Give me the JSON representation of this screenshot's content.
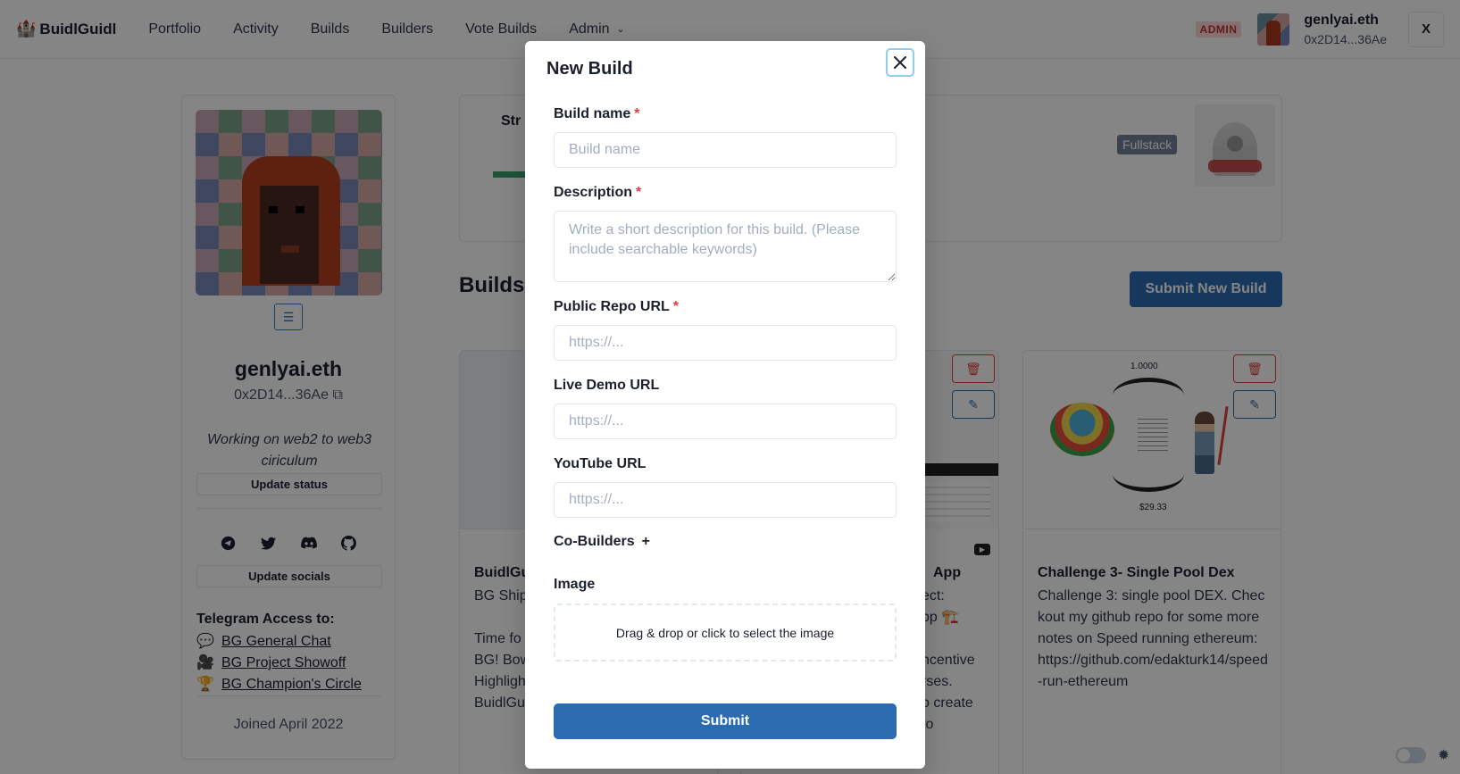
{
  "navbar": {
    "brand": "BuidlGuidl",
    "links": [
      "Portfolio",
      "Activity",
      "Builds",
      "Builders",
      "Vote Builds",
      "Admin"
    ],
    "admin_badge": "ADMIN",
    "user_name": "genlyai.eth",
    "user_address": "0x2D14...36Ae",
    "close_label": "X"
  },
  "profile": {
    "name": "genlyai.eth",
    "address": "0x2D14...36Ae",
    "status": "Working on web2 to web3 ciriculum",
    "update_status": "Update status",
    "update_socials": "Update socials",
    "telegram_title": "Telegram Access to:",
    "telegram_links": [
      {
        "emoji": "💬",
        "label": "BG General Chat"
      },
      {
        "emoji": "🎥",
        "label": "BG Project Showoff"
      },
      {
        "emoji": "🏆",
        "label": "BG Champion's Circle"
      }
    ],
    "joined": "Joined April 2022"
  },
  "top_card": {
    "streak_label": "Str",
    "role_badge": "Fullstack"
  },
  "builds": {
    "title": "Builds",
    "submit_new": "Submit New Build",
    "cards": [
      {
        "title": "BuidlGu",
        "description_lines": [
          "BG Ship",
          "",
          "Time fo",
          "BG! Bow",
          "Highligh",
          "BuidlGu"
        ]
      },
      {
        "title": "App",
        "description_lines": [
          "ect:",
          "pp 🏗️",
          "",
          "ncentive",
          "rses.",
          "o create",
          "to"
        ]
      },
      {
        "title": "Challenge 3- Single Pool Dex",
        "description": "Challenge 3: single pool DEX. Checkout my github repo for some more notes on Speed running ethereum: https://github.com/edakturk14/speed-run-ethereum",
        "image_label_top": "1.0000",
        "image_label_bottom": "$29.33"
      }
    ]
  },
  "modal": {
    "title": "New Build",
    "fields": {
      "build_name": {
        "label": "Build name",
        "placeholder": "Build name"
      },
      "description": {
        "label": "Description",
        "placeholder": "Write a short description for this build. (Please include searchable keywords)"
      },
      "repo_url": {
        "label": "Public Repo URL",
        "placeholder": "https://..."
      },
      "demo_url": {
        "label": "Live Demo URL",
        "placeholder": "https://..."
      },
      "youtube_url": {
        "label": "YouTube URL",
        "placeholder": "https://..."
      }
    },
    "required_mark": "*",
    "co_builders": "Co-Builders",
    "co_builders_add": "+",
    "image_label": "Image",
    "dropzone_text": "Drag & drop or click to select the image",
    "submit": "Submit"
  },
  "colors": {
    "primary": "#2b6cb0",
    "danger": "#e53e3e",
    "admin_badge_bg": "#fed7d7",
    "overlay": "rgba(0,0,0,0.48)"
  }
}
